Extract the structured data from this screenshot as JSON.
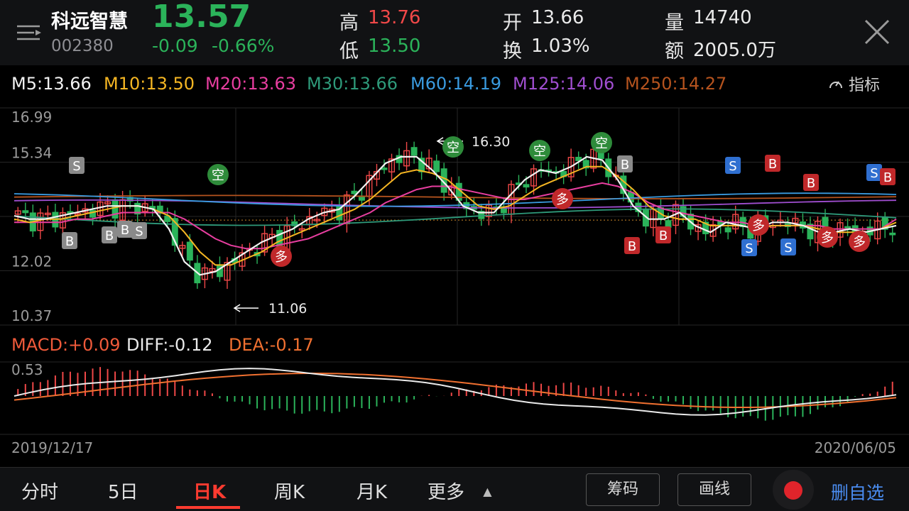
{
  "stock": {
    "name": "科远智慧",
    "code": "002380",
    "price": "13.57",
    "change": "-0.09",
    "change_pct": "-0.66%"
  },
  "quote": {
    "high_label": "高",
    "high": "13.76",
    "low_label": "低",
    "low": "13.50",
    "open_label": "开",
    "open": "13.66",
    "turnover_label": "换",
    "turnover": "1.03%",
    "volume_label": "量",
    "volume": "14740",
    "amount_label": "额",
    "amount": "2005.0万"
  },
  "ma_legend": [
    {
      "text": "M5:13.66",
      "color": "#f2f2f2"
    },
    {
      "text": "M10:13.50",
      "color": "#f5b623"
    },
    {
      "text": "M20:13.63",
      "color": "#e83ea0"
    },
    {
      "text": "M30:13.66",
      "color": "#2e9a7a"
    },
    {
      "text": "M60:14.19",
      "color": "#3a9be0"
    },
    {
      "text": "M125:14.06",
      "color": "#a04ed0"
    },
    {
      "text": "M250:14.27",
      "color": "#b5531e"
    }
  ],
  "indicator_label": "指标",
  "price_axis": [
    "16.99",
    "15.34",
    "12.02",
    "10.37"
  ],
  "annotations": {
    "high": "16.30",
    "low": "11.06"
  },
  "signal_labels": {
    "buy": "B",
    "sell": "S",
    "bull": "多",
    "bear": "空"
  },
  "macd_legend": {
    "macd": "MACD:+0.09",
    "diff": "DIFF:-0.12",
    "dea": "DEA:-0.17"
  },
  "macd_axis": [
    "0.53"
  ],
  "date_range": {
    "start": "2019/12/17",
    "end": "2020/06/05"
  },
  "tabs": [
    {
      "label": "分时",
      "active": false
    },
    {
      "label": "5日",
      "active": false
    },
    {
      "label": "日K",
      "active": true
    },
    {
      "label": "周K",
      "active": false
    },
    {
      "label": "月K",
      "active": false
    },
    {
      "label": "更多",
      "active": false
    }
  ],
  "tools": {
    "chips": "筹码",
    "draw": "画线",
    "favorite": "删自选"
  },
  "colors": {
    "up": "#f04848",
    "down": "#2bb35a",
    "background": "#000000",
    "accent": "#ff3b30",
    "link": "#4a8cf0"
  },
  "chart_data": {
    "type": "candlestick",
    "x_range": [
      "2019/12/17",
      "2020/06/05"
    ],
    "ylim": [
      10.37,
      16.99
    ],
    "high": 16.3,
    "low": 11.06,
    "ma_values": {
      "M5": 13.66,
      "M10": 13.5,
      "M20": 13.63,
      "M30": 13.66,
      "M60": 14.19,
      "M125": 14.06,
      "M250": 14.27
    },
    "m5_series": [
      13.7,
      13.6,
      13.6,
      13.7,
      13.8,
      13.9,
      14.0,
      14.0,
      14.0,
      13.9,
      13.3,
      12.3,
      11.9,
      12.0,
      12.3,
      12.6,
      12.9,
      13.1,
      13.3,
      13.6,
      13.8,
      13.9,
      14.3,
      14.8,
      15.3,
      15.5,
      15.5,
      15.1,
      14.6,
      14.0,
      13.8,
      13.8,
      14.3,
      14.8,
      15.1,
      15.0,
      15.2,
      15.5,
      15.4,
      14.8,
      14.0,
      13.6,
      13.6,
      13.8,
      13.4,
      13.2,
      13.5,
      13.4,
      13.3,
      13.5,
      13.5,
      13.4,
      13.2,
      13.2,
      13.3,
      13.2,
      13.3,
      13.4
    ],
    "m10_series": [
      13.6,
      13.5,
      13.6,
      13.6,
      13.7,
      13.8,
      13.9,
      14.0,
      14.0,
      13.9,
      13.7,
      13.2,
      12.6,
      12.2,
      12.2,
      12.4,
      12.6,
      12.9,
      13.1,
      13.3,
      13.5,
      13.7,
      13.9,
      14.2,
      14.6,
      15.0,
      15.1,
      15.0,
      14.8,
      14.4,
      14.0,
      13.9,
      14.0,
      14.3,
      14.6,
      14.8,
      15.0,
      15.2,
      15.2,
      14.9,
      14.5,
      14.0,
      13.7,
      13.6,
      13.6,
      13.4,
      13.4,
      13.4,
      13.3,
      13.4,
      13.4,
      13.4,
      13.3,
      13.2,
      13.2,
      13.2,
      13.3,
      13.5
    ],
    "m20_series": [
      13.5,
      13.5,
      13.5,
      13.5,
      13.6,
      13.6,
      13.7,
      13.8,
      13.8,
      13.8,
      13.8,
      13.6,
      13.3,
      13.0,
      12.8,
      12.7,
      12.7,
      12.8,
      12.9,
      13.0,
      13.2,
      13.4,
      13.6,
      13.8,
      14.1,
      14.3,
      14.5,
      14.6,
      14.6,
      14.5,
      14.4,
      14.3,
      14.2,
      14.2,
      14.3,
      14.4,
      14.5,
      14.6,
      14.7,
      14.6,
      14.4,
      14.1,
      13.9,
      13.8,
      13.7,
      13.6,
      13.5,
      13.5,
      13.4,
      13.4,
      13.4,
      13.4,
      13.4,
      13.3,
      13.3,
      13.3,
      13.3,
      13.6
    ],
    "macd": {
      "MACD": 0.09,
      "DIFF": -0.12,
      "DEA": -0.17,
      "axis_top": 0.53
    }
  }
}
